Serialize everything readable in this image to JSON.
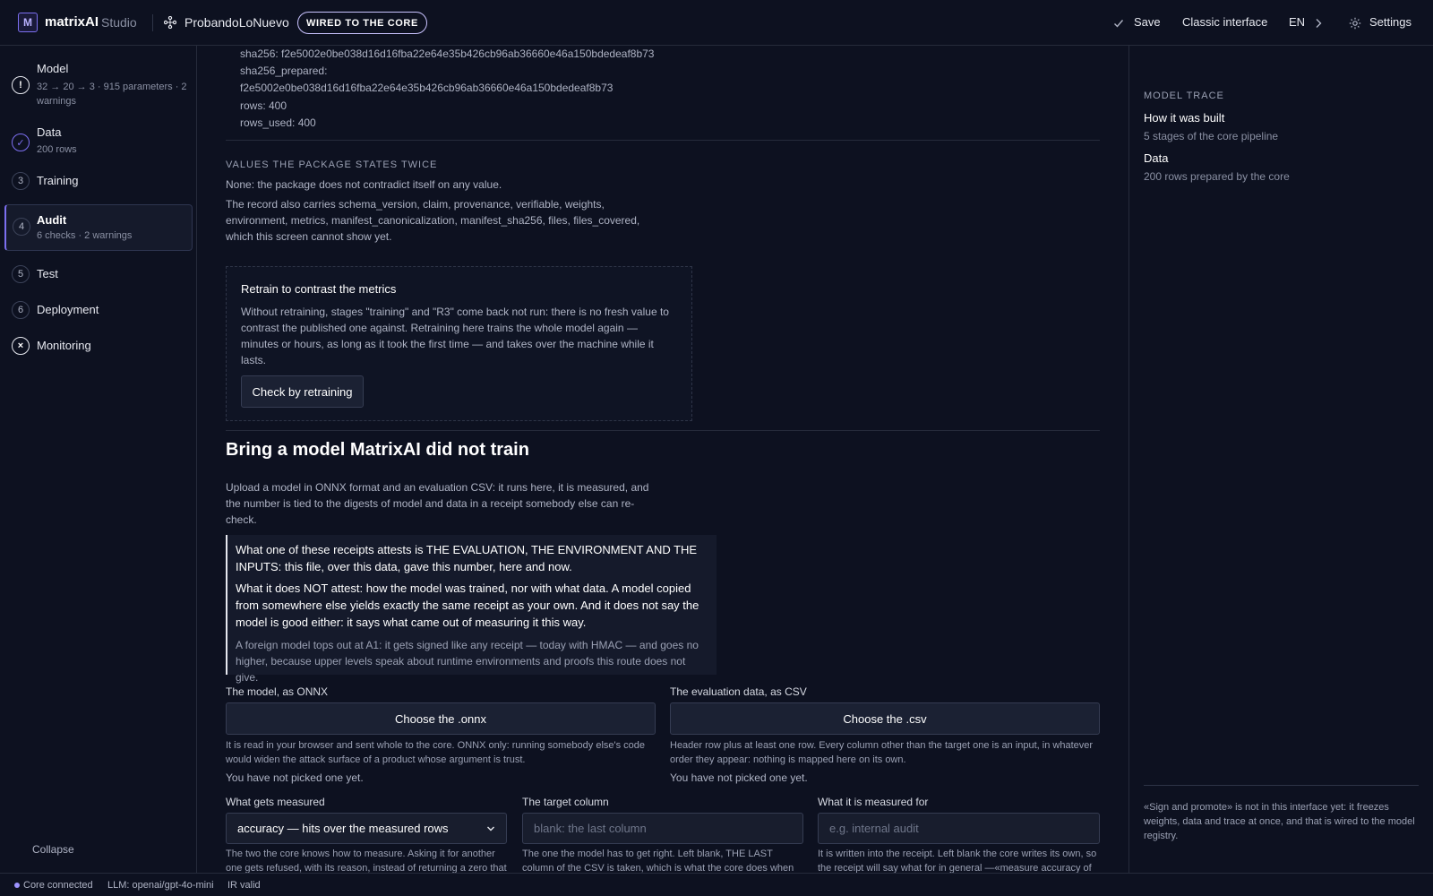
{
  "header": {
    "logo_letter": "M",
    "brand": "matrixAI",
    "brand_sub": "Studio",
    "project": "ProbandoLoNuevo",
    "badge": "WIRED TO THE CORE",
    "save": "Save",
    "classic": "Classic interface",
    "lang": "EN",
    "settings": "Settings"
  },
  "sidebar": {
    "items": [
      {
        "num": "!",
        "label": "Model",
        "sub": "32 → 20 → 3 · 915 parameters · 2 warnings"
      },
      {
        "num": "✓",
        "label": "Data",
        "sub": "200 rows"
      },
      {
        "num": "3",
        "label": "Training",
        "sub": ""
      },
      {
        "num": "4",
        "label": "Audit",
        "sub": "6 checks · 2 warnings"
      },
      {
        "num": "5",
        "label": "Test",
        "sub": ""
      },
      {
        "num": "6",
        "label": "Deployment",
        "sub": ""
      },
      {
        "num": "×",
        "label": "Monitoring",
        "sub": ""
      }
    ],
    "collapse": "Collapse"
  },
  "main": {
    "manifest_lines": [
      "sha256: f2e5002e0be038d16d16fba22e64e35b426cb96ab36660e46a150bdedeaf8b73",
      "sha256_prepared:",
      "f2e5002e0be038d16d16fba22e64e35b426cb96ab36660e46a150bdedeaf8b73",
      "rows: 400",
      "rows_used: 400"
    ],
    "twice_title": "VALUES THE PACKAGE STATES TWICE",
    "twice_none": "None: the package does not contradict itself on any value.",
    "twice_record": "The record also carries schema_version, claim, provenance, verifiable, weights, environment, metrics, manifest_canonicalization, manifest_sha256, files, files_covered, which this screen cannot show yet.",
    "retrain": {
      "title": "Retrain to contrast the metrics",
      "body": "Without retraining, stages \"training\" and \"R3\" come back not run: there is no fresh value to contrast the published one against. Retraining here trains the whole model again — minutes or hours, as long as it took the first time — and takes over the machine while it lasts.",
      "button": "Check by retraining"
    },
    "bring": {
      "title": "Bring a model MatrixAI did not train",
      "intro": "Upload a model in ONNX format and an evaluation CSV: it runs here, it is measured, and the number is tied to the digests of model and data in a receipt somebody else can re-check.",
      "callout1": "What one of these receipts attests is THE EVALUATION, THE ENVIRONMENT AND THE INPUTS: this file, over this data, gave this number, here and now.",
      "callout2": "What it does NOT attest: how the model was trained, nor with what data. A model copied from somewhere else yields exactly the same receipt as your own. And it does not say the model is good either: it says what came out of measuring it this way.",
      "callout3": "A foreign model tops out at A1: it gets signed like any receipt — today with HMAC — and goes no higher, because upper levels speak about runtime environments and proofs this route does not give.",
      "onnx_label": "The model, as ONNX",
      "onnx_button": "Choose the .onnx",
      "onnx_help": "It is read in your browser and sent whole to the core. ONNX only: running somebody else's code would widen the attack surface of a product whose argument is trust.",
      "onnx_status": "You have not picked one yet.",
      "csv_label": "The evaluation data, as CSV",
      "csv_button": "Choose the .csv",
      "csv_help": "Header row plus at least one row. Every column other than the target one is an input, in whatever order they appear: nothing is mapped here on its own.",
      "csv_status": "You have not picked one yet.",
      "measure_label": "What gets measured",
      "measure_value": "accuracy — hits over the measured rows",
      "measure_help": "The two the core knows how to measure. Asking it for another one gets refused, with its reason, instead of returning a zero that",
      "target_label": "The target column",
      "target_placeholder": "blank: the last column",
      "target_help": "The one the model has to get right. Left blank, THE LAST column of the CSV is taken, which is what the core does when",
      "purpose_label": "What it is measured for",
      "purpose_placeholder": "e.g. internal audit",
      "purpose_help": "It is written into the receipt. Left blank the core writes its own, so the receipt will say what for in general —«measure accuracy of"
    }
  },
  "right": {
    "title": "MODEL TRACE",
    "built_title": "How it was built",
    "built_sub": "5 stages of the core pipeline",
    "data_title": "Data",
    "data_sub": "200 rows prepared by the core",
    "note": "«Sign and promote» is not in this interface yet: it freezes weights, data and trace at once, and that is wired to the model registry."
  },
  "status": {
    "core": "Core connected",
    "llm": "LLM: openai/gpt-4o-mini",
    "ir": "IR valid"
  },
  "colors": {
    "accent": "#7c6ff0",
    "bg": "#0d1120"
  }
}
